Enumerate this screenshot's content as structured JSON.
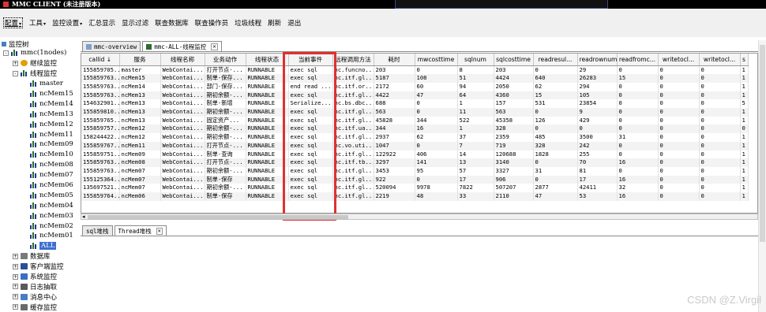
{
  "window": {
    "title": "MMC CLIENT (未注册版本)"
  },
  "menubar": {
    "items": [
      {
        "label": "配置",
        "has_arrow": true,
        "active": true
      },
      {
        "label": "工具",
        "has_arrow": true
      },
      {
        "label": "监控设置",
        "has_arrow": true
      },
      {
        "label": "汇总显示"
      },
      {
        "label": "显示过滤"
      },
      {
        "label": "联查数据库"
      },
      {
        "label": "联查操作员"
      },
      {
        "label": "垃圾线程"
      },
      {
        "label": "刷新"
      },
      {
        "label": "退出"
      }
    ]
  },
  "tree": {
    "header": "监控树",
    "items": [
      {
        "label": "mmc(1nodes)",
        "indent": 0,
        "expander": "-",
        "icon": "bar"
      },
      {
        "label": "继续监控",
        "indent": 1,
        "expander": "+",
        "icon": "sun"
      },
      {
        "label": "线程监控",
        "indent": 1,
        "expander": "-",
        "icon": "bar"
      },
      {
        "label": "master",
        "indent": 2,
        "icon": "bar"
      },
      {
        "label": "ncMem15",
        "indent": 2,
        "icon": "bar"
      },
      {
        "label": "ncMem14",
        "indent": 2,
        "icon": "bar"
      },
      {
        "label": "ncMem13",
        "indent": 2,
        "icon": "bar"
      },
      {
        "label": "ncMem12",
        "indent": 2,
        "icon": "bar"
      },
      {
        "label": "ncMem11",
        "indent": 2,
        "icon": "bar"
      },
      {
        "label": "ncMem09",
        "indent": 2,
        "icon": "bar"
      },
      {
        "label": "ncMem10",
        "indent": 2,
        "icon": "bar"
      },
      {
        "label": "ncMem08",
        "indent": 2,
        "icon": "bar"
      },
      {
        "label": "ncMem07",
        "indent": 2,
        "icon": "bar"
      },
      {
        "label": "ncMem06",
        "indent": 2,
        "icon": "bar"
      },
      {
        "label": "ncMem05",
        "indent": 2,
        "icon": "bar"
      },
      {
        "label": "ncMem04",
        "indent": 2,
        "icon": "bar"
      },
      {
        "label": "ncMem03",
        "indent": 2,
        "icon": "bar"
      },
      {
        "label": "ncMem02",
        "indent": 2,
        "icon": "bar"
      },
      {
        "label": "ncMem01",
        "indent": 2,
        "icon": "bar"
      },
      {
        "label": "ALL",
        "indent": 2,
        "icon": "bar",
        "selected": true
      },
      {
        "label": "数据库",
        "indent": 1,
        "expander": "+",
        "icon": "grid"
      },
      {
        "label": "客户端监控",
        "indent": 1,
        "expander": "+",
        "icon": "monitor"
      },
      {
        "label": "系统监控",
        "indent": 1,
        "expander": "+",
        "icon": "cloud"
      },
      {
        "label": "日志抽取",
        "indent": 1,
        "expander": "+",
        "icon": "search"
      },
      {
        "label": "消息中心",
        "indent": 1,
        "expander": "+",
        "icon": "chat"
      },
      {
        "label": "缓存监控",
        "indent": 1,
        "expander": "+",
        "icon": "pin"
      }
    ]
  },
  "tabs_top": [
    {
      "label": "mmc-overview",
      "active": false
    },
    {
      "label": "mmc-ALL-线程监控",
      "active": true,
      "closable": true
    }
  ],
  "table": {
    "columns": [
      "callid ↓",
      "服务",
      "线程名称",
      "业务动作",
      "线程状态",
      "当前事件",
      "远程调用方法",
      "耗时",
      "mwcosttime",
      "sqlnum",
      "sqlcosttime",
      "readresul...",
      "readrownum",
      "readfromc...",
      "writetocl...",
      "writetocl...",
      "s"
    ],
    "rows": [
      [
        "155859705...",
        "master",
        "WebContai...",
        "打开节点-...",
        "RUNNABLE",
        "exec sql",
        "nc.funcno...",
        "203",
        "0",
        "8",
        "203",
        "0",
        "29",
        "0",
        "0",
        "0",
        "1"
      ],
      [
        "155859763...",
        "ncMem15",
        "WebContai...",
        "制单-保存...",
        "RUNNABLE",
        "exec sql",
        "nc.itf.gl...",
        "5187",
        "108",
        "51",
        "4424",
        "640",
        "26283",
        "15",
        "0",
        "0",
        "1"
      ],
      [
        "155859763...",
        "ncMem14",
        "WebContai...",
        "部门-保存...",
        "RUNNABLE",
        "end read ...",
        "nc.itf.or...",
        "2172",
        "60",
        "94",
        "2050",
        "62",
        "294",
        "0",
        "0",
        "0",
        "1"
      ],
      [
        "155859763...",
        "ncMem13",
        "WebContai...",
        "期初余额-...",
        "RUNNABLE",
        "exec sql",
        "nc.itf.gl...",
        "4422",
        "47",
        "64",
        "4360",
        "15",
        "105",
        "0",
        "0",
        "0",
        "1"
      ],
      [
        "154632901...",
        "ncMem13",
        "WebContai...",
        "制单-新增",
        "RUNNABLE",
        "Serialize...",
        "nc.bs.dbc...",
        "688",
        "0",
        "1",
        "157",
        "531",
        "23854",
        "0",
        "0",
        "0",
        "5"
      ],
      [
        "155859810...",
        "ncMem13",
        "WebContai...",
        "期初余额-...",
        "RUNNABLE",
        "exec sql",
        "nc.itf.gl...",
        "563",
        "0",
        "11",
        "563",
        "0",
        "9",
        "0",
        "0",
        "0",
        "1"
      ],
      [
        "155859765...",
        "ncMem13",
        "WebContai...",
        "固定资产...",
        "RUNNABLE",
        "exec sql",
        "nc.itf.gl...",
        "45828",
        "344",
        "522",
        "45358",
        "126",
        "429",
        "0",
        "0",
        "0",
        "1"
      ],
      [
        "155859757...",
        "ncMem12",
        "WebContai...",
        "期初余额-...",
        "RUNNABLE",
        "exec sql",
        "nc.itf.ua...",
        "344",
        "16",
        "1",
        "328",
        "0",
        "0",
        "0",
        "0",
        "0",
        "0"
      ],
      [
        "158244422...",
        "ncMem12",
        "WebContai...",
        "期初余额-...",
        "RUNNABLE",
        "exec sql",
        "nc.itf.gl...",
        "2937",
        "62",
        "37",
        "2359",
        "485",
        "3500",
        "31",
        "0",
        "0",
        "1"
      ],
      [
        "155859767...",
        "ncMem11",
        "WebContai...",
        "打开节点-...",
        "RUNNABLE",
        "exec sql",
        "nc.vo.uti...",
        "1047",
        "0",
        "7",
        "719",
        "328",
        "242",
        "0",
        "0",
        "0",
        "1"
      ],
      [
        "155859751...",
        "ncMem09",
        "WebContai...",
        "制单-查询",
        "RUNNABLE",
        "exec sql",
        "nc.itf.gl...",
        "122922",
        "406",
        "14",
        "120688",
        "1828",
        "255",
        "0",
        "0",
        "0",
        "1"
      ],
      [
        "155859763...",
        "ncMem08",
        "WebContai...",
        "打开节点-...",
        "RUNNABLE",
        "exec sql",
        "nc.itf.tb...",
        "3297",
        "141",
        "13",
        "3140",
        "0",
        "70",
        "16",
        "0",
        "0",
        "1"
      ],
      [
        "155859763...",
        "ncMem07",
        "WebContai...",
        "期初余额-...",
        "RUNNABLE",
        "exec sql",
        "nc.itf.gl...",
        "3453",
        "95",
        "57",
        "3327",
        "31",
        "81",
        "0",
        "0",
        "0",
        "1"
      ],
      [
        "155125364...",
        "ncMem07",
        "WebContai...",
        "制单-保存",
        "RUNNABLE",
        "exec sql",
        "nc.itf.gl...",
        "922",
        "0",
        "17",
        "906",
        "0",
        "17",
        "16",
        "0",
        "0",
        "1"
      ],
      [
        "135697521...",
        "ncMem07",
        "WebContai...",
        "期初余额-...",
        "RUNNABLE",
        "exec sql",
        "nc.itf.gl...",
        "520094",
        "9978",
        "7822",
        "507207",
        "2877",
        "42411",
        "32",
        "0",
        "0",
        "1"
      ],
      [
        "155859764...",
        "ncMem06",
        "WebContai...",
        "制单-保存",
        "RUNNABLE",
        "exec sql",
        "nc.itf.gl...",
        "2219",
        "48",
        "33",
        "2110",
        "47",
        "53",
        "16",
        "0",
        "0",
        "1"
      ]
    ]
  },
  "tabs_bottom": [
    {
      "label": "sql堆栈",
      "active": false
    },
    {
      "label": "Thread堆栈",
      "active": true,
      "closable": true
    }
  ],
  "close_glyph": "✕",
  "watermark": "CSDN @Z.Virgil",
  "colors": {
    "highlight_box": "#e03030",
    "selection": "#3b6fd0"
  }
}
